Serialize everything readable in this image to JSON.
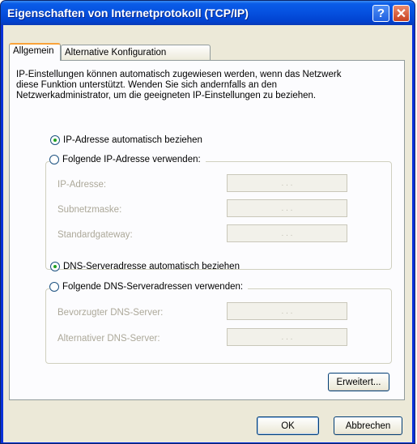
{
  "window": {
    "title": "Eigenschaften von Internetprotokoll (TCP/IP)",
    "help_glyph": "?",
    "close_glyph": "✕"
  },
  "tabs": [
    {
      "label": "Allgemein",
      "selected": true
    },
    {
      "label": "Alternative Konfiguration",
      "selected": false
    }
  ],
  "intro_text": "IP-Einstellungen können automatisch zugewiesen werden, wenn das Netzwerk diese Funktion unterstützt. Wenden Sie sich andernfalls an den Netzwerkadministrator, um die geeigneten IP-Einstellungen zu beziehen.",
  "ip": {
    "auto_label": "IP-Adresse automatisch beziehen",
    "auto_selected": true,
    "manual_label": "Folgende IP-Adresse verwenden:",
    "fields": [
      {
        "label": "IP-Adresse:",
        "value": ". . ."
      },
      {
        "label": "Subnetzmaske:",
        "value": ". . ."
      },
      {
        "label": "Standardgateway:",
        "value": ". . ."
      }
    ]
  },
  "dns": {
    "auto_label": "DNS-Serveradresse automatisch beziehen",
    "auto_selected": true,
    "manual_label": "Folgende DNS-Serveradressen verwenden:",
    "fields": [
      {
        "label": "Bevorzugter DNS-Server:",
        "value": ". . ."
      },
      {
        "label": "Alternativer DNS-Server:",
        "value": ". . ."
      }
    ]
  },
  "buttons": {
    "advanced": "Erweitert...",
    "ok": "OK",
    "cancel": "Abbrechen"
  },
  "colors": {
    "titlebar": "#0550df",
    "dialog_bg": "#ece9d8",
    "tab_highlight": "#f9a33a",
    "radio_dot": "#21a121"
  }
}
